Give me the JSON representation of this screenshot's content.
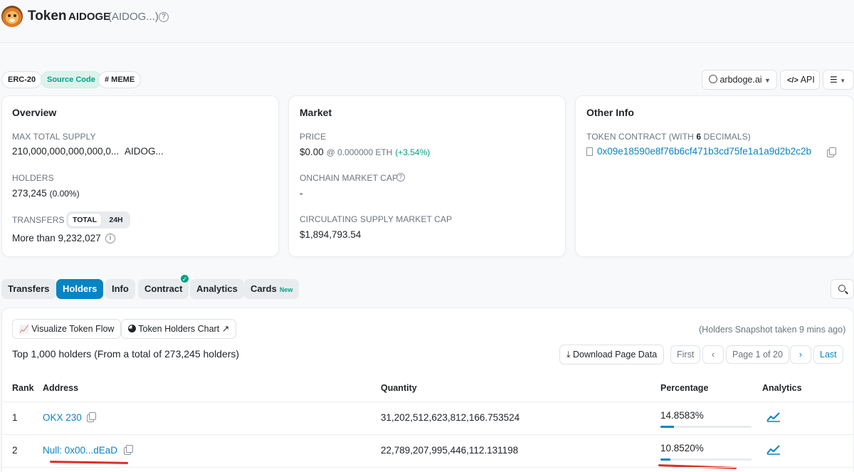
{
  "header": {
    "title": "Token",
    "name": "AIDOGE",
    "symbol": "(AIDOG...)"
  },
  "tags": {
    "erc": "ERC-20",
    "source": "Source Code",
    "meme": "# MEME"
  },
  "actions": {
    "website": "arbdoge.ai",
    "api": "API"
  },
  "overview": {
    "title": "Overview",
    "supply_label": "MAX TOTAL SUPPLY",
    "supply_value": "210,000,000,000,000,0...",
    "supply_symbol": "AIDOG...",
    "holders_label": "HOLDERS",
    "holders_value": "273,245",
    "holders_change": "(0.00%)",
    "transfers_label": "TRANSFERS",
    "transfers_toggle": [
      "TOTAL",
      "24H"
    ],
    "transfers_value": "More than 9,232,027"
  },
  "market": {
    "title": "Market",
    "price_label": "PRICE",
    "price_value": "$0.00",
    "price_eth": "@ 0.000000 ETH",
    "price_change": "(+3.54%)",
    "onchain_label": "ONCHAIN MARKET CAP",
    "onchain_value": "-",
    "circ_label": "CIRCULATING SUPPLY MARKET CAP",
    "circ_value": "$1,894,793.54"
  },
  "other": {
    "title": "Other Info",
    "contract_label": "TOKEN CONTRACT (WITH",
    "contract_decimals": "6",
    "contract_label_end": "DECIMALS)",
    "contract_address": "0x09e18590e8f76b6cf471b3cd75fe1a1a9d2b2c2b"
  },
  "tabs": [
    "Transfers",
    "Holders",
    "Info",
    "Contract",
    "Analytics",
    "Cards"
  ],
  "tab_badge": "New",
  "holders": {
    "visualize": "Visualize Token Flow",
    "chart": "Token Holders Chart",
    "snapshot": "(Holders Snapshot taken 9 mins ago)",
    "summary": "Top 1,000 holders (From a total of 273,245 holders)",
    "download": "Download Page Data",
    "pager": {
      "first": "First",
      "page": "Page 1 of 20",
      "last": "Last"
    },
    "columns": [
      "Rank",
      "Address",
      "Quantity",
      "Percentage",
      "Analytics"
    ],
    "rows": [
      {
        "rank": "1",
        "address": "OKX 230",
        "quantity": "31,202,512,623,812,166.753524",
        "percentage": "14.8583%",
        "pct": 14.8583
      },
      {
        "rank": "2",
        "address": "Null: 0x00...dEaD",
        "quantity": "22,789,207,995,446,112.131198",
        "percentage": "10.8520%",
        "pct": 10.852
      }
    ]
  },
  "colors": {
    "accent": "#0784c3",
    "green": "#00a186",
    "annotation": "#d93025"
  }
}
